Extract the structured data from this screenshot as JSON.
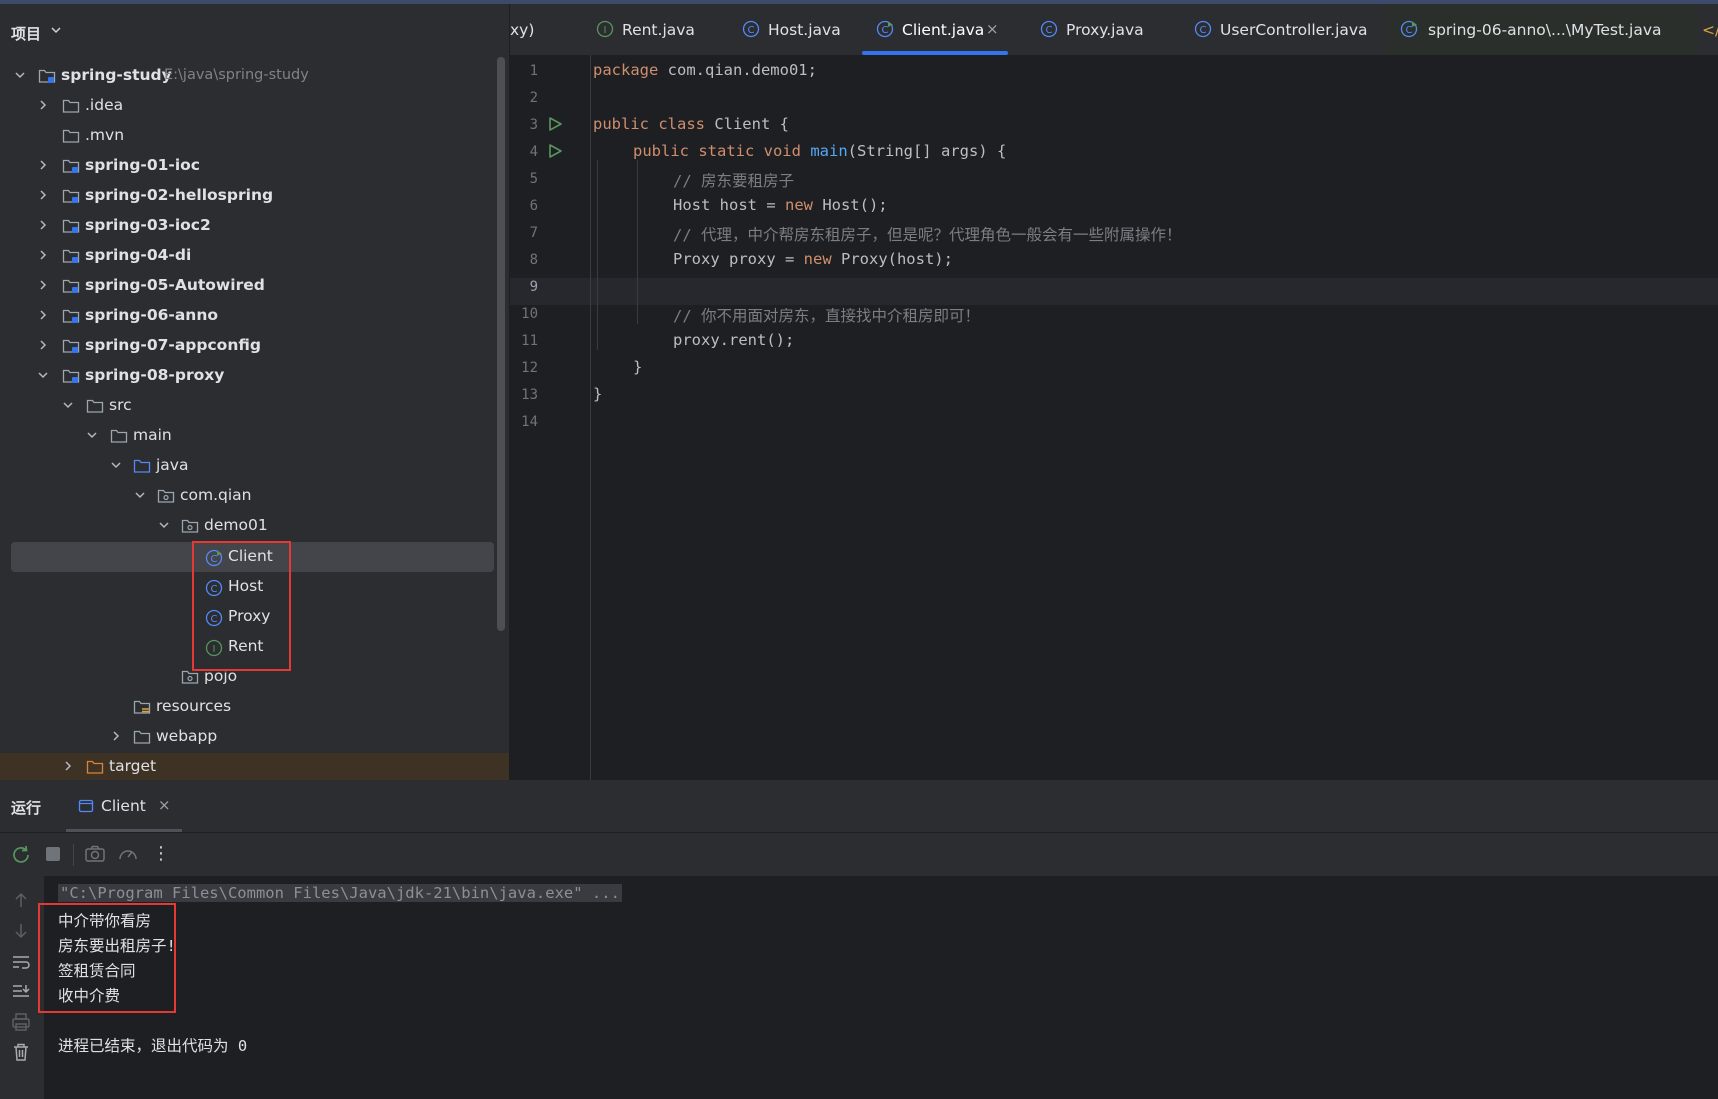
{
  "project": {
    "title": "项目",
    "root": {
      "name": "spring-study",
      "path": "E:\\java\\spring-study"
    },
    "items": [
      {
        "label": ".idea"
      },
      {
        "label": ".mvn"
      },
      {
        "label": "spring-01-ioc"
      },
      {
        "label": "spring-02-hellospring"
      },
      {
        "label": "spring-03-ioc2"
      },
      {
        "label": "spring-04-di"
      },
      {
        "label": "spring-05-Autowired"
      },
      {
        "label": "spring-06-anno"
      },
      {
        "label": "spring-07-appconfig"
      },
      {
        "label": "spring-08-proxy"
      },
      {
        "label": "src"
      },
      {
        "label": "main"
      },
      {
        "label": "java"
      },
      {
        "label": "com.qian"
      },
      {
        "label": "demo01"
      },
      {
        "label": "Client"
      },
      {
        "label": "Host"
      },
      {
        "label": "Proxy"
      },
      {
        "label": "Rent"
      },
      {
        "label": "pojo"
      },
      {
        "label": "resources"
      },
      {
        "label": "webapp"
      },
      {
        "label": "target"
      }
    ]
  },
  "tabs": [
    {
      "label": "xy)"
    },
    {
      "label": "Rent.java"
    },
    {
      "label": "Host.java"
    },
    {
      "label": "Client.java"
    },
    {
      "label": "Proxy.java"
    },
    {
      "label": "UserController.java"
    },
    {
      "label": "spring-06-anno\\...\\MyTest.java"
    }
  ],
  "editor": {
    "line_numbers": [
      "1",
      "2",
      "3",
      "4",
      "5",
      "6",
      "7",
      "8",
      "9",
      "10",
      "11",
      "12",
      "13",
      "14"
    ],
    "code": {
      "l1_kw": "package",
      "l1_rest": " com.qian.demo01;",
      "l3_kw": "public class",
      "l3_rest": " Client {",
      "l4_kw": "public static void",
      "l4_fn": "main",
      "l4_rest": "(String[] args) {",
      "l5": "// 房东要租房子",
      "l6_a": "Host host = ",
      "l6_kw": "new",
      "l6_b": " Host();",
      "l7": "// 代理，中介帮房东租房子，但是呢？代理角色一般会有一些附属操作！",
      "l8_a": "Proxy proxy = ",
      "l8_kw": "new",
      "l8_b": " Proxy(host);",
      "l10": "// 你不用面对房东，直接找中介租房即可！",
      "l11": "proxy.rent();",
      "l12": "}",
      "l13": "}"
    }
  },
  "run": {
    "title": "运行",
    "tab_label": "Client",
    "console": {
      "command": "\"C:\\Program Files\\Common Files\\Java\\jdk-21\\bin\\java.exe\" ...",
      "lines": [
        "中介带你看房",
        "房东要出租房子!",
        "签租赁合同",
        "收中介费"
      ],
      "exit": "进程已结束，退出代码为 0"
    }
  },
  "colors": {
    "accent": "#3574f0",
    "run_green": "#57965c",
    "highlight": "#e53935"
  }
}
